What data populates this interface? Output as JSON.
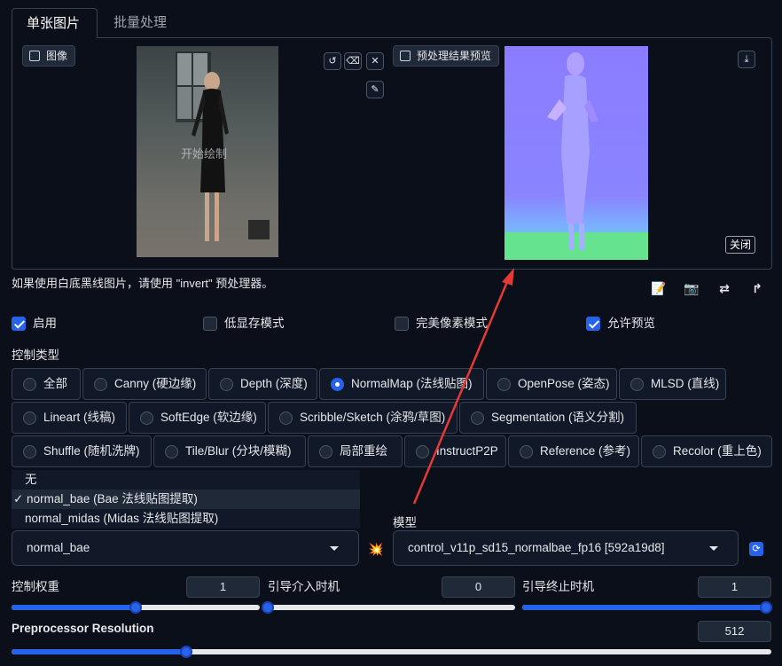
{
  "tabs": [
    {
      "label": "单张图片",
      "active": true
    },
    {
      "label": "批量处理",
      "active": false
    }
  ],
  "left_image_panel": {
    "label": "图像",
    "overlay_text": "开始绘制"
  },
  "right_image_panel": {
    "label": "预处理结果预览",
    "close_label": "关闭"
  },
  "hint_text": "如果使用白底黑线图片，请使用 \"invert\" 预处理器。",
  "tools": [
    {
      "icon": "edit-icon",
      "glyph": "📝"
    },
    {
      "icon": "camera-icon",
      "glyph": "📷"
    },
    {
      "icon": "swap-icon",
      "glyph": "⇄"
    },
    {
      "icon": "send-dimensions-icon",
      "glyph": "↱"
    }
  ],
  "checkboxes": [
    {
      "label": "启用",
      "checked": true
    },
    {
      "label": "低显存模式",
      "checked": false
    },
    {
      "label": "完美像素模式",
      "checked": false
    },
    {
      "label": "允许预览",
      "checked": true
    }
  ],
  "control_type": {
    "label": "控制类型",
    "options": [
      "全部",
      "Canny (硬边缘)",
      "Depth (深度)",
      "NormalMap (法线贴图)",
      "OpenPose (姿态)",
      "MLSD (直线)",
      "Lineart (线稿)",
      "SoftEdge (软边缘)",
      "Scribble/Sketch (涂鸦/草图)",
      "Segmentation (语义分割)",
      "Shuffle (随机洗牌)",
      "Tile/Blur (分块/模糊)",
      "局部重绘",
      "InstructP2P",
      "Reference (参考)",
      "Recolor (重上色)"
    ],
    "selected": "NormalMap (法线贴图)"
  },
  "preprocessor": {
    "options": [
      "无",
      "✓ normal_bae (Bae 法线贴图提取)",
      "normal_midas (Midas 法线贴图提取)"
    ],
    "value": "normal_bae"
  },
  "model": {
    "label": "模型",
    "value": "control_v11p_sd15_normalbae_fp16 [592a19d8]"
  },
  "sliders": {
    "weight": {
      "label": "控制权重",
      "value": "1",
      "fraction": 0.5
    },
    "start": {
      "label": "引导介入时机",
      "value": "0",
      "fraction": 0.0
    },
    "end": {
      "label": "引导终止时机",
      "value": "1",
      "fraction": 1.0
    },
    "resolution": {
      "label": "Preprocessor Resolution",
      "value": "512",
      "fraction": 0.23
    }
  },
  "colors": {
    "accent": "#2563eb",
    "background": "#0b0f19",
    "arrow": "#e53935"
  }
}
